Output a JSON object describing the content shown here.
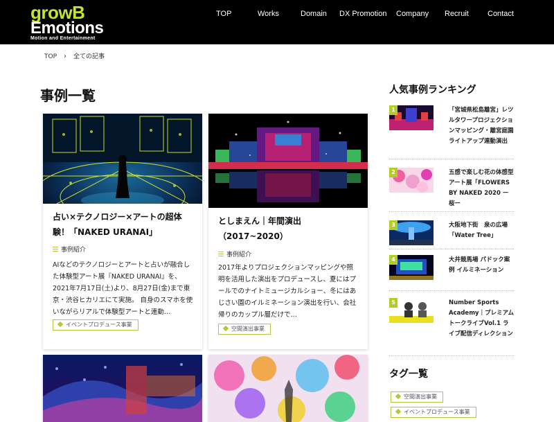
{
  "header": {
    "logo": {
      "line1": "growB",
      "line2": "Emotions",
      "tagline": "Motion and Entertainment"
    },
    "nav": [
      "TOP",
      "Works",
      "Domain",
      "DX Promotion",
      "Company",
      "Recruit",
      "Contact"
    ]
  },
  "breadcrumb": {
    "home": "TOP",
    "separator": "›",
    "current": "全ての記事"
  },
  "page_title": "事例一覧",
  "cards": [
    {
      "title": "占い×テクノロジー×アートの超体験！「NAKED URANAI」",
      "category": "事例紹介",
      "excerpt": "AIなどのテクノロジーとアートと占いが融合した体験型アート展『NAKED URANAI』を、2021年7月17日(土)より、8月27日(金)まで東京・渋谷ヒカリエにて実施。 自身のスマホを使いながらリアルで体験型アートと連動…",
      "tag": "イベントプロデュース事業"
    },
    {
      "title": "としまえん｜年間演出（2017~2020）",
      "category": "事例紹介",
      "excerpt": "2017年よりプロジェクションマッピングや照明を活用した演出をプロデュースし、夏にはプールでのナイトミュージカルショー、冬にはあじさい園のイルミネーション演出を行い、会社帰りのカップル層だけで…",
      "tag": "空間演出事業"
    }
  ],
  "sidebar": {
    "ranking_heading": "人気事例ランキング",
    "ranking": [
      {
        "num": "1",
        "title": "「宮城県松島離宮」レツルタワープロジェクションマッピング・離宮庭園ライトアップ連動演出"
      },
      {
        "num": "2",
        "title": "五感で楽しむ花の体感型アート展「FLOWERS BY NAKED 2020 ー桜ー"
      },
      {
        "num": "3",
        "title": "大阪地下街　泉の広場「Water Tree」"
      },
      {
        "num": "4",
        "title": "大井競馬場 パドック案例 イルミネーション"
      },
      {
        "num": "5",
        "title": "Number Sports Academy｜プレミアムトークライブVol.1 ライブ配信ディレクション"
      }
    ],
    "tags_heading": "タグ一覧",
    "tags": [
      "空間演出事業",
      "イベントプロデュース事業"
    ]
  },
  "colors": {
    "accent": "#b4cc2a",
    "logo_green": "#c3e234",
    "header_bg": "#000000"
  }
}
